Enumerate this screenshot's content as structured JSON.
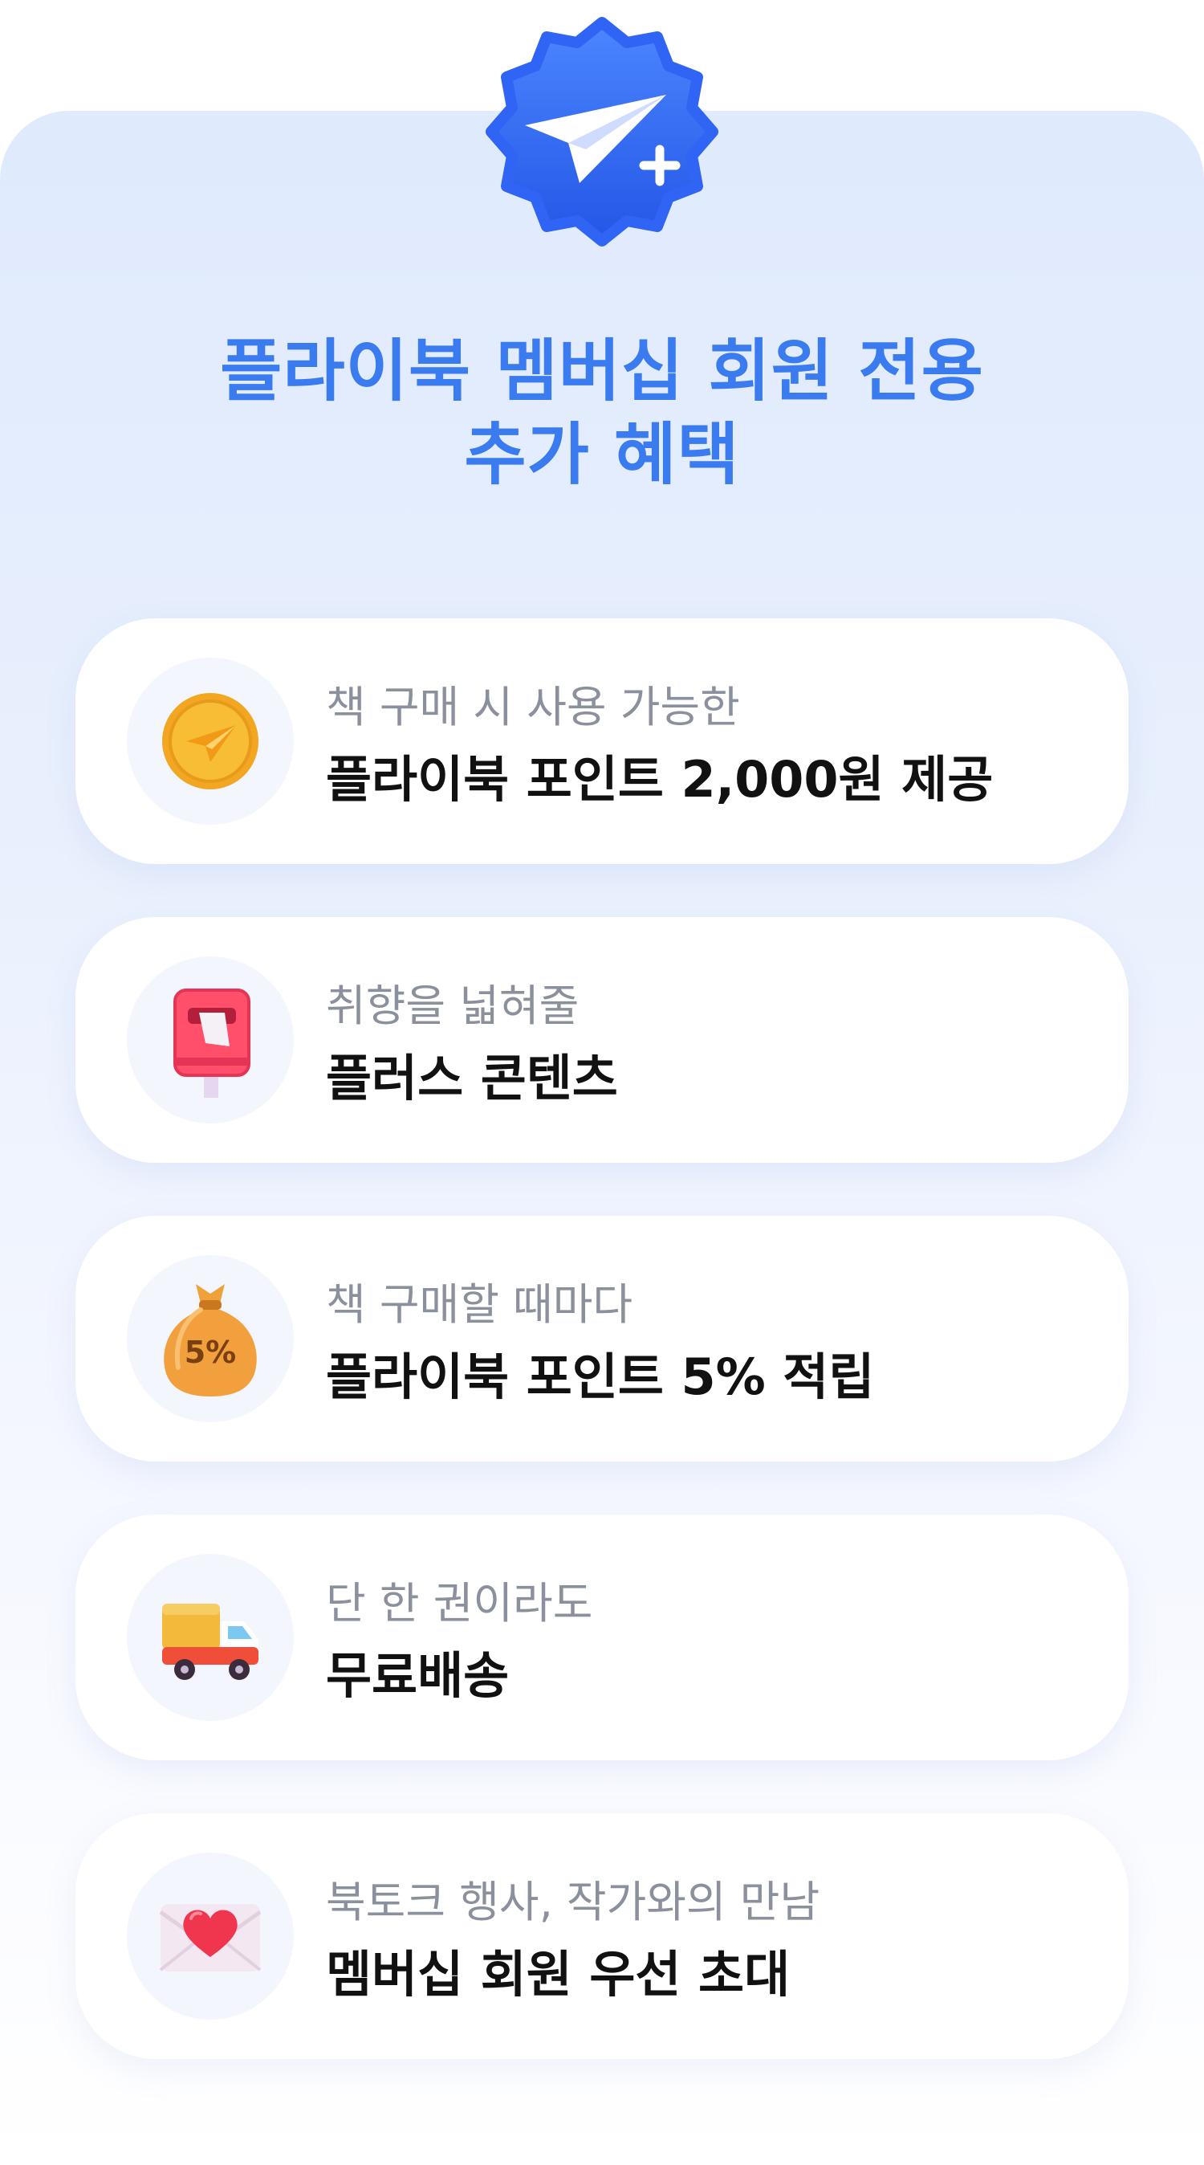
{
  "header": {
    "badge_icon": "paper-plane-plus-badge-icon",
    "title_line1": "플라이북 멤버십 회원 전용",
    "title_line2": "추가 혜택"
  },
  "colors": {
    "accent": "#3a7bf0",
    "badge_blue": "#2f64f5",
    "subtitle_gray": "#8a909c",
    "main_text": "#111111"
  },
  "benefits": [
    {
      "icon": "coin-icon",
      "subtitle": "책 구매 시 사용 가능한",
      "title": "플라이북 포인트 2,000원 제공"
    },
    {
      "icon": "mailbox-icon",
      "subtitle": "취향을 넓혀줄",
      "title": "플러스 콘텐츠"
    },
    {
      "icon": "money-bag-icon",
      "subtitle": "책 구매할 때마다",
      "title": "플라이북 포인트 5% 적립",
      "icon_text": "5%"
    },
    {
      "icon": "delivery-truck-icon",
      "subtitle": "단 한 권이라도",
      "title": "무료배송"
    },
    {
      "icon": "love-letter-icon",
      "subtitle": "북토크 행사, 작가와의 만남",
      "title": "멤버십 회원 우선 초대"
    }
  ]
}
